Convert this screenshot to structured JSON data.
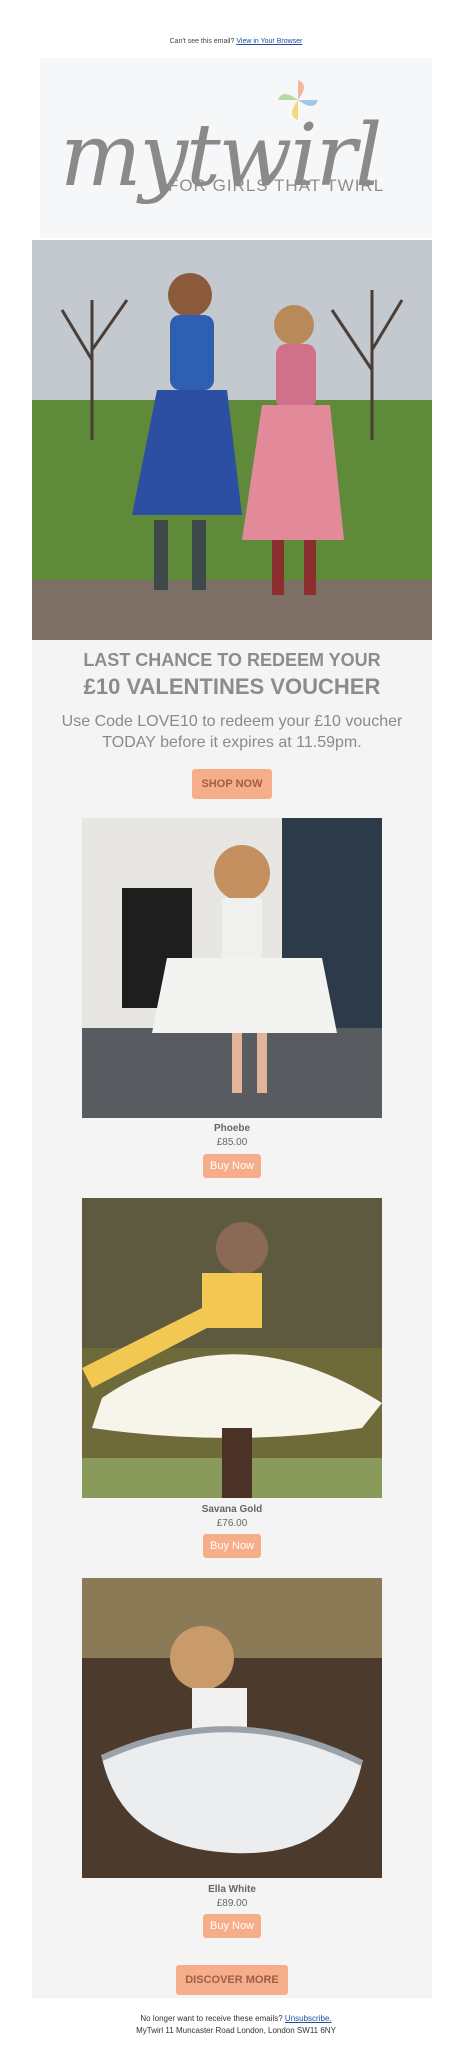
{
  "preheader": {
    "text": "Can't see this email?",
    "link": "View in Your Browser"
  },
  "logo": {
    "wordmark": "mytwirl",
    "tagline": "FOR GIRLS THAT TWIRL"
  },
  "hero": {
    "icon": "hero-photo-two-girls"
  },
  "headline": {
    "line1": "LAST CHANCE TO REDEEM YOUR",
    "line2": "£10 VALENTINES VOUCHER"
  },
  "description": "Use Code LOVE10 to redeem your £10 voucher TODAY before it expires at 11.59pm.",
  "shop_now": "SHOP NOW",
  "products": [
    {
      "name": "Phoebe",
      "price": "£85.00",
      "button": "Buy Now"
    },
    {
      "name": "Savana Gold",
      "price": "£76.00",
      "button": "Buy Now"
    },
    {
      "name": "Ella White",
      "price": "£89.00",
      "button": "Buy Now"
    }
  ],
  "discover": "DISCOVER MORE",
  "footer": {
    "question": "No longer want to receive these emails?",
    "unsubscribe": "Unsubscribe.",
    "address": "MyTwirl 11 Muncaster Road London, London SW11 6NY"
  },
  "colors": {
    "accent": "#f6ad8a",
    "panel": "#f4f4f4",
    "link": "#1a4fa0"
  }
}
